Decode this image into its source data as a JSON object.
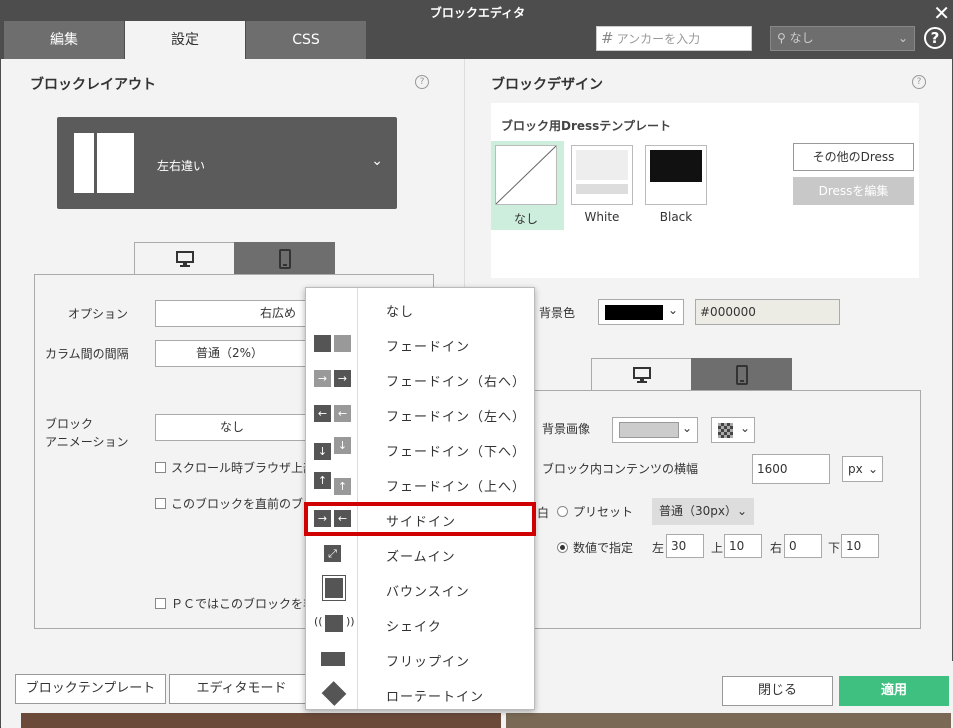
{
  "window": {
    "title": "ブロックエディタ",
    "close": "✕"
  },
  "tabs": [
    {
      "label": "編集"
    },
    {
      "label": "設定"
    },
    {
      "label": "CSS"
    }
  ],
  "anchor": {
    "placeholder": "アンカーを入力",
    "hash": "#"
  },
  "header_dropdown": {
    "value": "なし",
    "icon": "person-icon"
  },
  "help": "?",
  "left": {
    "title": "ブロックレイアウト",
    "layout": {
      "name": "左右違い"
    },
    "option": {
      "label": "オプション",
      "value": "右広め"
    },
    "column_gap": {
      "label": "カラム間の間隔",
      "value": "普通（2%）"
    },
    "animation": {
      "label1": "ブロック",
      "label2": "アニメーション",
      "value": "なし"
    },
    "checks": [
      "スクロール時ブラウザ上部",
      "このブロックを直前のブ",
      "ＰＣではこのブロックを非"
    ]
  },
  "right": {
    "title": "ブロックデザイン",
    "dress": {
      "title": "ブロック用Dressテンプレート",
      "items": [
        {
          "label": "なし"
        },
        {
          "label": "White"
        },
        {
          "label": "Black"
        }
      ],
      "other": "その他のDress",
      "edit": "Dressを編集"
    },
    "bg_color": {
      "label": "背景色",
      "value": "#000000"
    },
    "bg_image": {
      "label": "背景画像"
    },
    "content_width": {
      "label": "ブロック内コンテンツの横幅",
      "value": "1600",
      "unit": "px"
    },
    "margin": {
      "label": "白",
      "preset_label": "プリセット",
      "preset_value": "普通（30px）",
      "custom_label": "数値で指定",
      "left_label": "左",
      "left": "30",
      "top_label": "上",
      "top": "10",
      "right_label": "右",
      "right": "0",
      "bottom_label": "下",
      "bottom": "10"
    }
  },
  "menu": {
    "items": [
      {
        "label": "なし",
        "icon": "none"
      },
      {
        "label": "フェードイン",
        "icon": "fade-in-icon"
      },
      {
        "label": "フェードイン（右へ）",
        "icon": "fade-right-icon"
      },
      {
        "label": "フェードイン（左へ）",
        "icon": "fade-left-icon"
      },
      {
        "label": "フェードイン（下へ）",
        "icon": "fade-down-icon"
      },
      {
        "label": "フェードイン（上へ）",
        "icon": "fade-up-icon"
      },
      {
        "label": "サイドイン",
        "icon": "side-in-icon"
      },
      {
        "label": "ズームイン",
        "icon": "zoom-in-icon"
      },
      {
        "label": "バウンスイン",
        "icon": "bounce-in-icon"
      },
      {
        "label": "シェイク",
        "icon": "shake-icon"
      },
      {
        "label": "フリップイン",
        "icon": "flip-in-icon"
      },
      {
        "label": "ローテートイン",
        "icon": "rotate-in-icon"
      }
    ]
  },
  "footer": {
    "template": "ブロックテンプレート",
    "editor_mode": "エディタモード",
    "close": "閉じる",
    "apply": "適用"
  },
  "colors": {
    "accent": "#40c080",
    "highlight": "#d10000",
    "header": "#4d4d4d"
  }
}
